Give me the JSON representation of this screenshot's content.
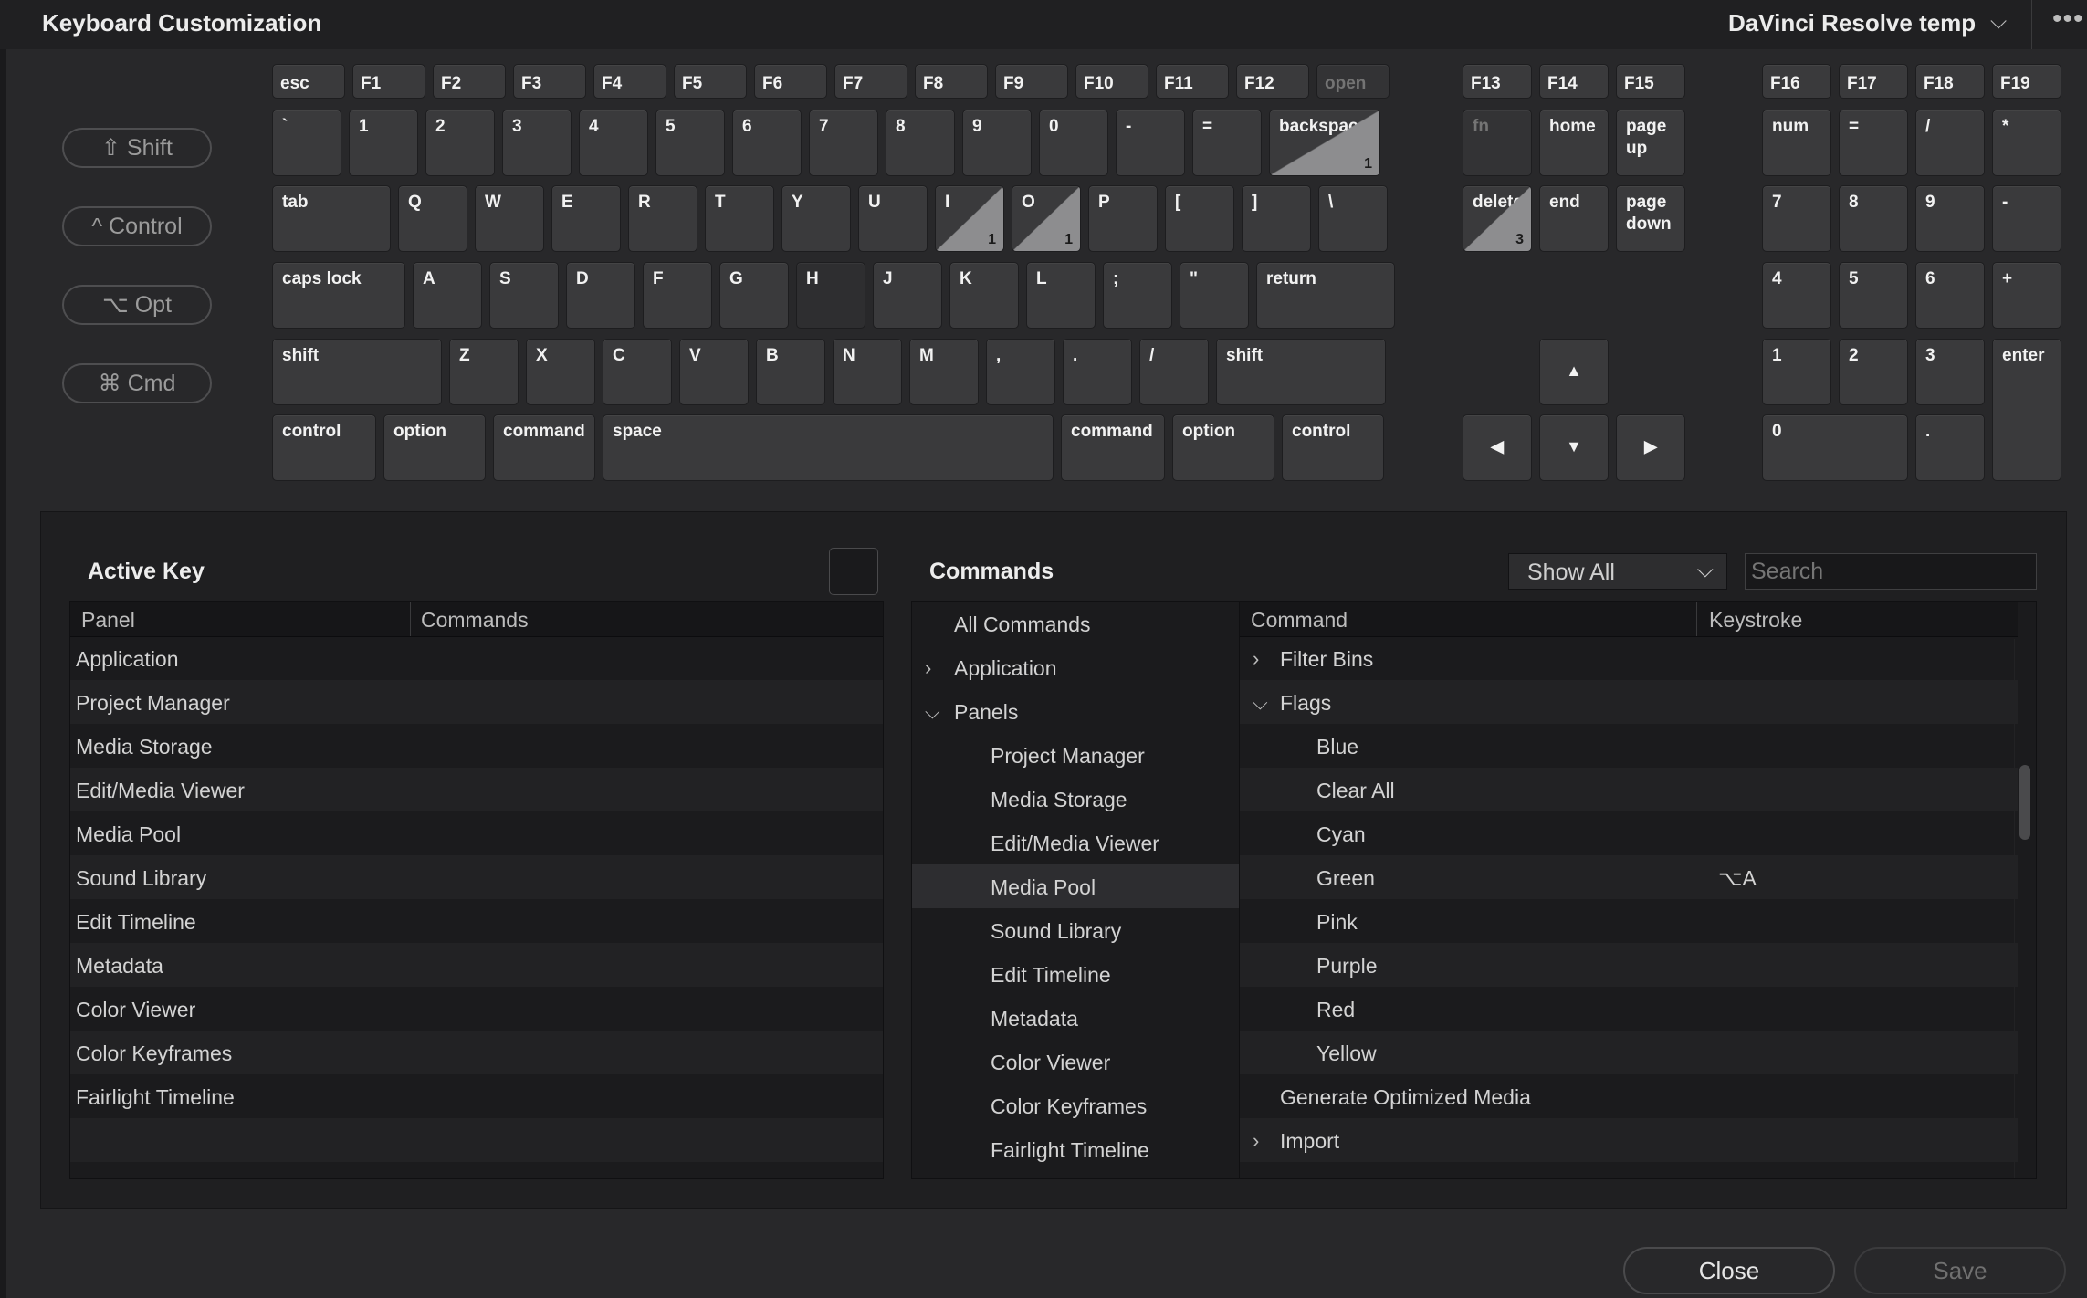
{
  "window": {
    "title": "Keyboard Customization",
    "preset": "DaVinci Resolve temp",
    "preset_chevron": "⌵",
    "more": "•••"
  },
  "modifiers": [
    "⇧ Shift",
    "^ Control",
    "⌥ Opt",
    "⌘ Cmd"
  ],
  "keyboard": {
    "row_f": [
      "esc",
      "F1",
      "F2",
      "F3",
      "F4",
      "F5",
      "F6",
      "F7",
      "F8",
      "F9",
      "F10",
      "F11",
      "F12",
      "open"
    ],
    "row_num": [
      "`",
      "1",
      "2",
      "3",
      "4",
      "5",
      "6",
      "7",
      "8",
      "9",
      "0",
      "-",
      "=",
      "backspace"
    ],
    "row_tab": [
      "tab",
      "Q",
      "W",
      "E",
      "R",
      "T",
      "Y",
      "U",
      "I",
      "O",
      "P",
      "[",
      "]",
      "\\"
    ],
    "row_caps": [
      "caps lock",
      "A",
      "S",
      "D",
      "F",
      "G",
      "H",
      "J",
      "K",
      "L",
      ";",
      "\"",
      "return"
    ],
    "row_shift": [
      "shift",
      "Z",
      "X",
      "C",
      "V",
      "B",
      "N",
      "M",
      ",",
      ".",
      "/",
      "shift"
    ],
    "row_bottom": [
      "control",
      "option",
      "command",
      "space",
      "command",
      "option",
      "control"
    ],
    "nav_f": [
      "F13",
      "F14",
      "F15"
    ],
    "nav_1": [
      "fn",
      "home",
      "page\nup"
    ],
    "nav_2": [
      "delete",
      "end",
      "page\ndown"
    ],
    "arrows": [
      "▲",
      "◀",
      "▼",
      "▶"
    ],
    "pad_f": [
      "F16",
      "F17",
      "F18",
      "F19"
    ],
    "pad_1": [
      "num",
      "=",
      "/",
      "*"
    ],
    "pad_2": [
      "7",
      "8",
      "9",
      "-"
    ],
    "pad_3": [
      "4",
      "5",
      "6",
      "+"
    ],
    "pad_4": [
      "1",
      "2",
      "3",
      "enter"
    ],
    "pad_5": [
      "0",
      "."
    ],
    "counts": {
      "backspace": "1",
      "I": "1",
      "O": "1",
      "delete": "3"
    }
  },
  "active_key": {
    "title": "Active Key",
    "columns": [
      "Panel",
      "Commands"
    ],
    "rows": [
      "Application",
      "Project Manager",
      "Media Storage",
      "Edit/Media Viewer",
      "Media Pool",
      "Sound Library",
      "Edit Timeline",
      "Metadata",
      "Color Viewer",
      "Color Keyframes",
      "Fairlight Timeline"
    ]
  },
  "commands": {
    "title": "Commands",
    "filter": "Show All",
    "filter_chevron": "⌵",
    "search_placeholder": "Search",
    "tree": [
      {
        "label": "All Commands",
        "indent": 0,
        "chevron": ""
      },
      {
        "label": "Application",
        "indent": 0,
        "chevron": "›"
      },
      {
        "label": "Panels",
        "indent": 0,
        "chevron": "⌵"
      },
      {
        "label": "Project Manager",
        "indent": 1,
        "chevron": ""
      },
      {
        "label": "Media Storage",
        "indent": 1,
        "chevron": ""
      },
      {
        "label": "Edit/Media Viewer",
        "indent": 1,
        "chevron": ""
      },
      {
        "label": "Media Pool",
        "indent": 1,
        "chevron": "",
        "selected": true
      },
      {
        "label": "Sound Library",
        "indent": 1,
        "chevron": ""
      },
      {
        "label": "Edit Timeline",
        "indent": 1,
        "chevron": ""
      },
      {
        "label": "Metadata",
        "indent": 1,
        "chevron": ""
      },
      {
        "label": "Color Viewer",
        "indent": 1,
        "chevron": ""
      },
      {
        "label": "Color Keyframes",
        "indent": 1,
        "chevron": ""
      },
      {
        "label": "Fairlight Timeline",
        "indent": 1,
        "chevron": ""
      }
    ],
    "columns": [
      "Command",
      "Keystroke"
    ],
    "list": [
      {
        "label": "Filter Bins",
        "indent": 0,
        "chevron": "›",
        "keystroke": ""
      },
      {
        "label": "Flags",
        "indent": 0,
        "chevron": "⌵",
        "keystroke": ""
      },
      {
        "label": "Blue",
        "indent": 1,
        "chevron": "",
        "keystroke": ""
      },
      {
        "label": "Clear All",
        "indent": 1,
        "chevron": "",
        "keystroke": ""
      },
      {
        "label": "Cyan",
        "indent": 1,
        "chevron": "",
        "keystroke": ""
      },
      {
        "label": "Green",
        "indent": 1,
        "chevron": "",
        "keystroke": "⌥A"
      },
      {
        "label": "Pink",
        "indent": 1,
        "chevron": "",
        "keystroke": ""
      },
      {
        "label": "Purple",
        "indent": 1,
        "chevron": "",
        "keystroke": ""
      },
      {
        "label": "Red",
        "indent": 1,
        "chevron": "",
        "keystroke": ""
      },
      {
        "label": "Yellow",
        "indent": 1,
        "chevron": "",
        "keystroke": ""
      },
      {
        "label": "Generate Optimized Media",
        "indent": 0,
        "chevron": "",
        "keystroke": ""
      },
      {
        "label": "Import",
        "indent": 0,
        "chevron": "›",
        "keystroke": ""
      }
    ]
  },
  "buttons": {
    "close": "Close",
    "save": "Save"
  }
}
